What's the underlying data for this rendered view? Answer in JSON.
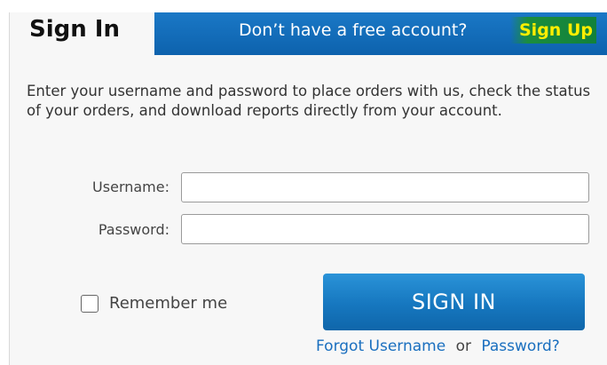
{
  "header": {
    "title": "Sign In",
    "banner_text": "Don’t have a free account?",
    "signup_link": "Sign Up"
  },
  "intro": {
    "text": "Enter your username and password to place orders with us, check the status of your orders, and download reports directly from your account."
  },
  "form": {
    "username_label": "Username:",
    "username_value": "",
    "password_label": "Password:",
    "password_value": "",
    "remember_label": "Remember me",
    "remember_checked": false,
    "submit_label": "SIGN IN"
  },
  "forgot": {
    "username_link": "Forgot Username",
    "separator": "or",
    "password_link": "Password?"
  },
  "colors": {
    "banner": "#0d62ad",
    "signup_highlight": "#12813a",
    "signup_text": "#ffee00",
    "button": "#1677bf",
    "link": "#1a6fbf"
  }
}
